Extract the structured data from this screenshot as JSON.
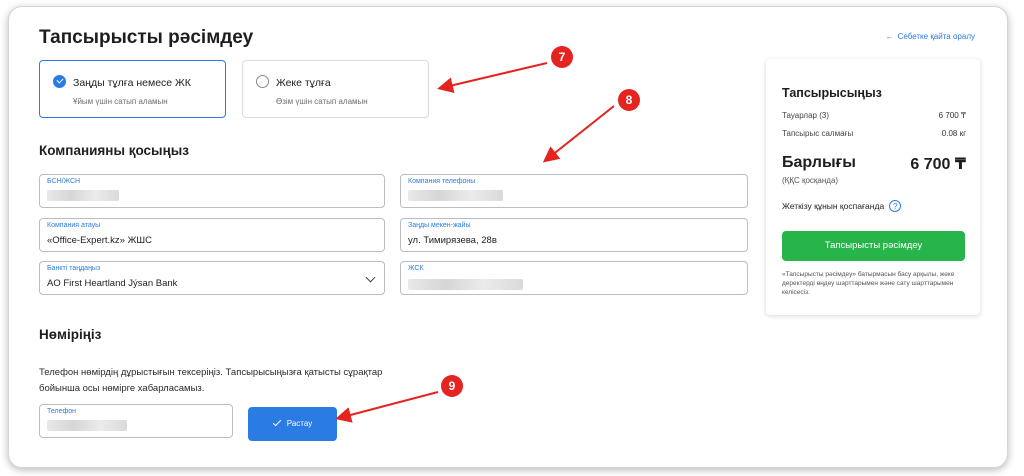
{
  "page": {
    "title": "Тапсырысты рәсімдеу",
    "back_link": "Себетке қайта оралу"
  },
  "customer_type": [
    {
      "title": "Заңды тұлға немесе ЖК",
      "subtitle": "Ұйым үшін сатып аламын",
      "selected": true
    },
    {
      "title": "Жеке тұлға",
      "subtitle": "Өзім үшін сатып аламын",
      "selected": false
    }
  ],
  "company": {
    "section_title": "Компанияны қосыңыз",
    "bin_label": "БСН/ЖСН",
    "phone_label": "Компания телефоны",
    "name_label": "Компания атауы",
    "name_value": "«Office-Expert.kz» ЖШС",
    "address_label": "Заңды мекен-жайы",
    "address_value": "ул. Тимирязева, 28в",
    "bank_label": "Банкті таңдаңыз",
    "bank_value": "AO First Heartland Jýsan Bank",
    "iban_label": "ЖСК"
  },
  "phone_section": {
    "title": "Нөміріңіз",
    "description": "Телефон нөмірдің дұрыстығын тексеріңіз. Тапсырысыңызға қатысты сұрақтар бойынша осы нөмірге хабарласамыз.",
    "phone_label": "Телефон",
    "confirm_label": "Растау"
  },
  "summary": {
    "title": "Тапсырысыңыз",
    "items_label": "Тауарлар (3)",
    "items_value": "6 700 ₸",
    "weight_label": "Тапсырыс салмағы",
    "weight_value": "0.08 кг",
    "total_label": "Барлығы",
    "total_value": "6 700 ₸",
    "vat_note": "(ҚҚС қосқанда)",
    "delivery_note": "Жеткізу құнын қоспағанда",
    "help_icon": "?",
    "submit_label": "Тапсырысты рәсімдеу",
    "legal_note": "«Тапсырысты рәсімдеу» батырмасын басу арқылы, жеке деректерді өңдеу шарттарымен және сату шарттарымен келісесіз."
  },
  "annotations": {
    "badges": [
      "7",
      "8",
      "9"
    ],
    "color": "#e52420"
  },
  "colors": {
    "accent": "#2a7be4",
    "submit": "#27b54b"
  },
  "icons": {
    "back": "arrow-left-icon",
    "selected_radio": "check-icon",
    "dropdown": "chevron-down-icon",
    "confirm": "check-icon",
    "help": "question-circle-icon"
  }
}
